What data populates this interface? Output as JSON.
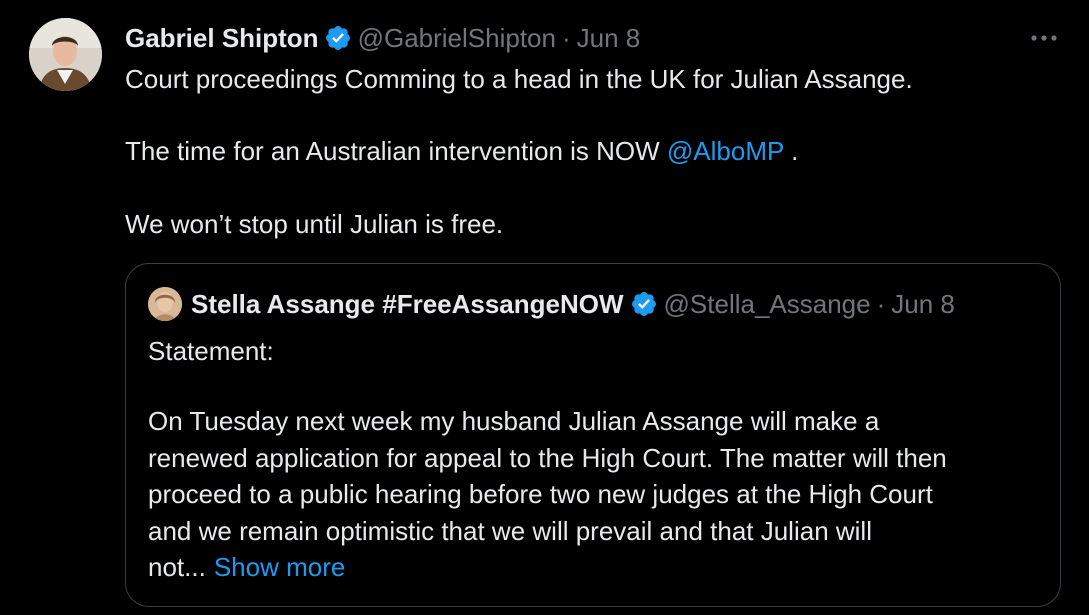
{
  "tweet": {
    "author_name": "Gabriel Shipton",
    "handle": "@GabrielShipton",
    "separator": "·",
    "date": "Jun 8",
    "lines": [
      "Court proceedings Comming to a head in the UK for Julian Assange.",
      "The time for an Australian intervention is NOW",
      "We won’t stop until Julian is free."
    ],
    "mention": "@AlboMP",
    "mention_suffix": " ."
  },
  "quote": {
    "author_name": "Stella Assange #FreeAssangeNOW",
    "handle": "@Stella_Assange",
    "separator": "·",
    "date": "Jun 8",
    "heading": "Statement:",
    "body_lines": [
      "On Tuesday next week my husband Julian Assange will make a",
      "renewed application for appeal to the High Court. The matter will then",
      "proceed to a public hearing before two new judges at the High Court",
      "and we remain optimistic that we will prevail and that Julian will",
      "not..."
    ],
    "show_more": "Show more"
  },
  "colors": {
    "background": "#000000",
    "text": "#e7e9ea",
    "secondary": "#71767b",
    "link": "#1d9bf0",
    "border": "#3a3d41"
  },
  "icons": {
    "verified": "verified-badge-icon",
    "more": "more-horizontal-icon"
  }
}
